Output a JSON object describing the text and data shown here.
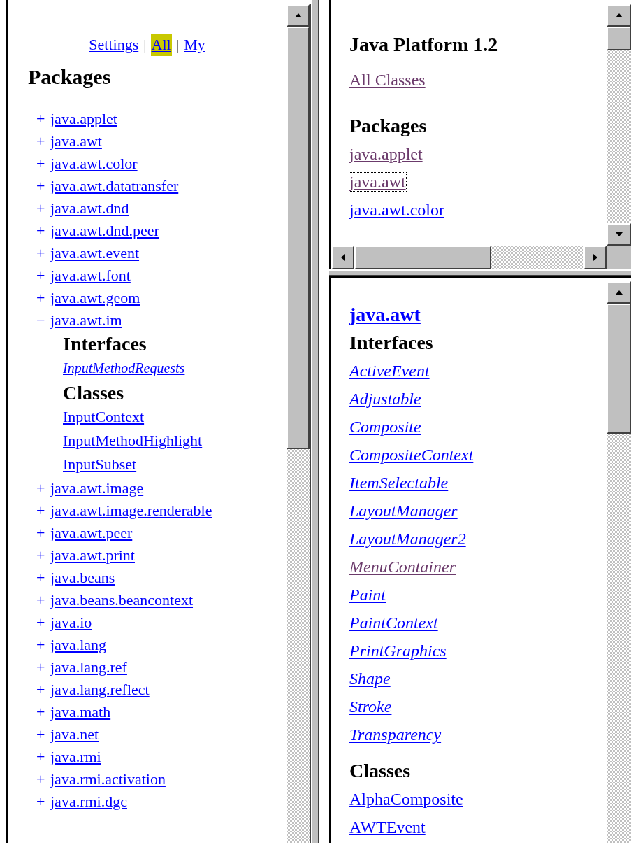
{
  "left_frame": {
    "nav": [
      {
        "label": "Settings",
        "selected": false
      },
      {
        "label": "All",
        "selected": true
      },
      {
        "label": "My",
        "selected": false
      }
    ],
    "separator": "|",
    "heading": "Packages",
    "packages": [
      {
        "toggle": "+",
        "label": "java.applet"
      },
      {
        "toggle": "+",
        "label": "java.awt"
      },
      {
        "toggle": "+",
        "label": "java.awt.color"
      },
      {
        "toggle": "+",
        "label": "java.awt.datatransfer"
      },
      {
        "toggle": "+",
        "label": "java.awt.dnd"
      },
      {
        "toggle": "+",
        "label": "java.awt.dnd.peer"
      },
      {
        "toggle": "+",
        "label": "java.awt.event"
      },
      {
        "toggle": "+",
        "label": "java.awt.font"
      },
      {
        "toggle": "+",
        "label": "java.awt.geom"
      },
      {
        "toggle": "−",
        "label": "java.awt.im",
        "children": [
          {
            "heading": "Interfaces",
            "kind": "interface",
            "items": [
              "InputMethodRequests"
            ]
          },
          {
            "heading": "Classes",
            "kind": "class",
            "items": [
              "InputContext",
              "InputMethodHighlight",
              "InputSubset"
            ]
          }
        ]
      },
      {
        "toggle": "+",
        "label": "java.awt.image"
      },
      {
        "toggle": "+",
        "label": "java.awt.image.renderable"
      },
      {
        "toggle": "+",
        "label": "java.awt.peer"
      },
      {
        "toggle": "+",
        "label": "java.awt.print"
      },
      {
        "toggle": "+",
        "label": "java.beans"
      },
      {
        "toggle": "+",
        "label": "java.beans.beancontext"
      },
      {
        "toggle": "+",
        "label": "java.io"
      },
      {
        "toggle": "+",
        "label": "java.lang"
      },
      {
        "toggle": "+",
        "label": "java.lang.ref"
      },
      {
        "toggle": "+",
        "label": "java.lang.reflect"
      },
      {
        "toggle": "+",
        "label": "java.math"
      },
      {
        "toggle": "+",
        "label": "java.net"
      },
      {
        "toggle": "+",
        "label": "java.rmi"
      },
      {
        "toggle": "+",
        "label": "java.rmi.activation"
      },
      {
        "toggle": "+",
        "label": "java.rmi.dgc"
      }
    ]
  },
  "overview_frame": {
    "title": "Java Platform 1.2",
    "all_classes": {
      "label": "All Classes",
      "visited": true
    },
    "heading": "Packages",
    "packages": [
      {
        "label": "java.applet",
        "visited": true,
        "focused": false
      },
      {
        "label": "java.awt",
        "visited": true,
        "focused": true
      },
      {
        "label": "java.awt.color",
        "visited": false,
        "focused": false
      }
    ]
  },
  "package_frame": {
    "title": "java.awt",
    "sections": [
      {
        "heading": "Interfaces",
        "kind": "interface",
        "items": [
          {
            "label": "ActiveEvent",
            "visited": false
          },
          {
            "label": "Adjustable",
            "visited": false
          },
          {
            "label": "Composite",
            "visited": false
          },
          {
            "label": "CompositeContext",
            "visited": false
          },
          {
            "label": "ItemSelectable",
            "visited": false
          },
          {
            "label": "LayoutManager",
            "visited": false
          },
          {
            "label": "LayoutManager2",
            "visited": false
          },
          {
            "label": "MenuContainer",
            "visited": true
          },
          {
            "label": "Paint",
            "visited": false
          },
          {
            "label": "PaintContext",
            "visited": false
          },
          {
            "label": "PrintGraphics",
            "visited": false
          },
          {
            "label": "Shape",
            "visited": false
          },
          {
            "label": "Stroke",
            "visited": false
          },
          {
            "label": "Transparency",
            "visited": false
          }
        ]
      },
      {
        "heading": "Classes",
        "kind": "class",
        "items": [
          {
            "label": "AlphaComposite",
            "visited": false
          },
          {
            "label": "AWTEvent",
            "visited": false
          }
        ]
      }
    ]
  }
}
